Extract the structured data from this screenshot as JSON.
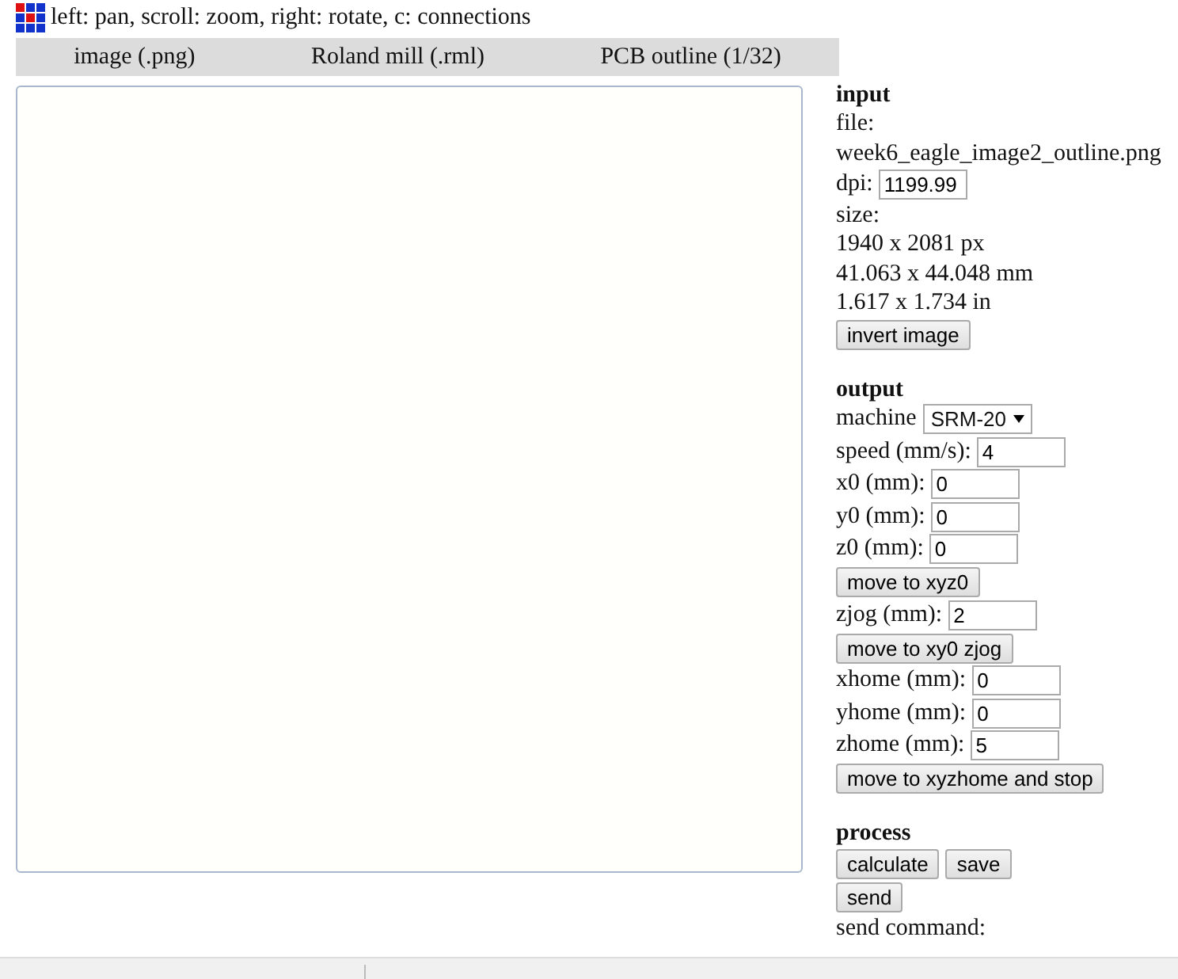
{
  "header": {
    "hint": "left: pan, scroll: zoom, right: rotate, c: connections"
  },
  "modules": [
    "image (.png)",
    "Roland mill (.rml)",
    "PCB outline (1/32)"
  ],
  "panel": [
    {
      "kind": "heading",
      "text": "input"
    },
    {
      "kind": "text",
      "text": "file:"
    },
    {
      "kind": "text",
      "text": "week6_eagle_image2_outline.png"
    },
    {
      "kind": "field",
      "label": "dpi:",
      "value": "1199.99"
    },
    {
      "kind": "text",
      "text": "size:"
    },
    {
      "kind": "text",
      "text": "1940 x 2081 px"
    },
    {
      "kind": "text",
      "text": "41.063 x 44.048 mm"
    },
    {
      "kind": "text",
      "text": "1.617 x 1.734 in"
    },
    {
      "kind": "buttons",
      "buttons": [
        "invert image"
      ]
    },
    {
      "kind": "heading",
      "text": "output"
    },
    {
      "kind": "select",
      "label": "machine",
      "value": "SRM-20"
    },
    {
      "kind": "field",
      "label": "speed (mm/s):",
      "value": "4"
    },
    {
      "kind": "field",
      "label": "x0 (mm):",
      "value": "0"
    },
    {
      "kind": "field",
      "label": "y0 (mm):",
      "value": "0"
    },
    {
      "kind": "field",
      "label": "z0 (mm):",
      "value": "0"
    },
    {
      "kind": "buttons",
      "buttons": [
        "move to xyz0"
      ]
    },
    {
      "kind": "field",
      "label": "zjog (mm):",
      "value": "2"
    },
    {
      "kind": "buttons",
      "buttons": [
        "move to xy0 zjog"
      ]
    },
    {
      "kind": "field",
      "label": "xhome (mm):",
      "value": "0"
    },
    {
      "kind": "field",
      "label": "yhome (mm):",
      "value": "0"
    },
    {
      "kind": "field",
      "label": "zhome (mm):",
      "value": "5"
    },
    {
      "kind": "buttons",
      "buttons": [
        "move to xyzhome and stop"
      ]
    },
    {
      "kind": "heading",
      "text": "process"
    },
    {
      "kind": "buttons",
      "buttons": [
        "calculate",
        "save"
      ]
    },
    {
      "kind": "buttons",
      "buttons": [
        "send"
      ]
    },
    {
      "kind": "text",
      "text": "send command:"
    }
  ]
}
